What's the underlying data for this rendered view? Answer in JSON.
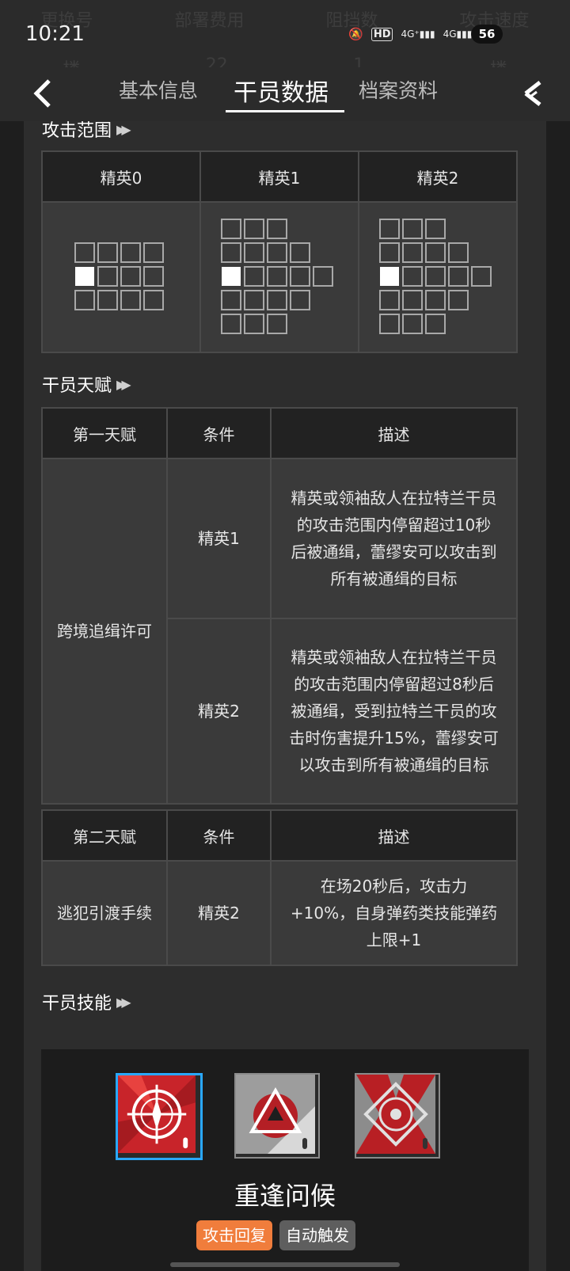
{
  "status": {
    "time": "10:21",
    "battery": "56"
  },
  "ghost_header": [
    "更换号",
    "部署费用",
    "阻挡数",
    "攻击速度"
  ],
  "ghost_values": [
    "楼",
    "22",
    "1",
    "楼"
  ],
  "tabs": [
    "基本信息",
    "干员数据",
    "档案资料"
  ],
  "active_tab": 1,
  "range": {
    "title": "攻击范围",
    "headers": [
      "精英0",
      "精英1",
      "精英2"
    ]
  },
  "talent1": {
    "title": "干员天赋",
    "headers": [
      "第一天赋",
      "条件",
      "描述"
    ],
    "name": "跨境追缉许可",
    "rows": [
      {
        "condition": "精英1",
        "description": "精英或领袖敌人在拉特兰干员的攻击范围内停留超过10秒后被通缉，蕾缪安可以攻击到所有被通缉的目标"
      },
      {
        "condition": "精英2",
        "description": "精英或领袖敌人在拉特兰干员的攻击范围内停留超过8秒后被通缉，受到拉特兰干员的攻击时伤害提升15%，蕾缪安可以攻击到所有被通缉的目标"
      }
    ]
  },
  "talent2": {
    "headers": [
      "第二天赋",
      "条件",
      "描述"
    ],
    "name": "逃犯引渡手续",
    "condition": "精英2",
    "description": "在场20秒后，攻击力+10%，自身弹药类技能弹药上限+1"
  },
  "skills": {
    "title": "干员技能",
    "selected_name": "重逢问候",
    "tags": [
      "攻击回复",
      "自动触发"
    ],
    "tag_colors": [
      "#f07d3c",
      "#5e5e5e"
    ],
    "icon_names": [
      "crosshair-skill-icon",
      "triangle-skill-icon",
      "diamond-skill-icon"
    ],
    "selected_index": 0
  }
}
